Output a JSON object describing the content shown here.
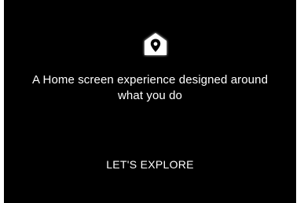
{
  "app": {
    "logo_icon": "home-location-pin-icon",
    "tagline_line1": "A Home screen experience designed around",
    "tagline_line2": "what you do",
    "cta_label": "LET'S EXPLORE"
  },
  "colors": {
    "background": "#000000",
    "text": "#ffffff",
    "frame": "#ffffff"
  }
}
